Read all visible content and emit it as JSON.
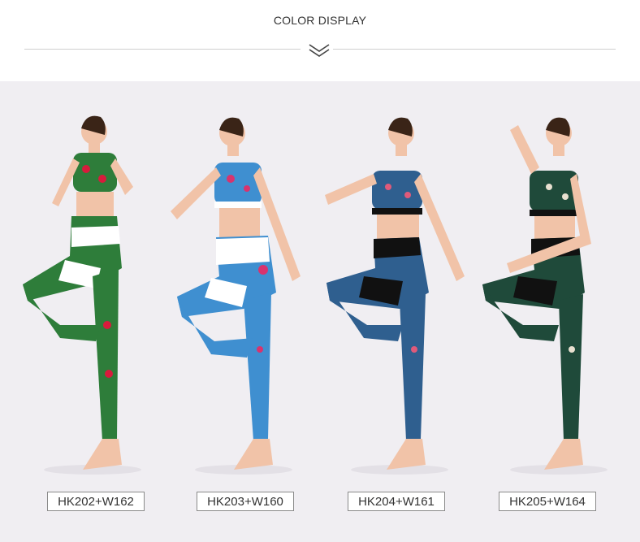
{
  "header": {
    "title": "COLOR DISPLAY",
    "divider_icon": "double-chevron-down-icon"
  },
  "products": [
    {
      "code": "HK202+W162",
      "color": "#2e7d3a",
      "accent": "#d81b3c",
      "panel": "#ffffff"
    },
    {
      "code": "HK203+W160",
      "color": "#3f8fd0",
      "accent": "#d8336e",
      "panel": "#ffffff"
    },
    {
      "code": "HK204+W161",
      "color": "#2f5f8f",
      "accent": "#e05a7a",
      "panel": "#111111"
    },
    {
      "code": "HK205+W164",
      "color": "#1f4a3a",
      "accent": "#e8e0d0",
      "panel": "#111111"
    }
  ]
}
